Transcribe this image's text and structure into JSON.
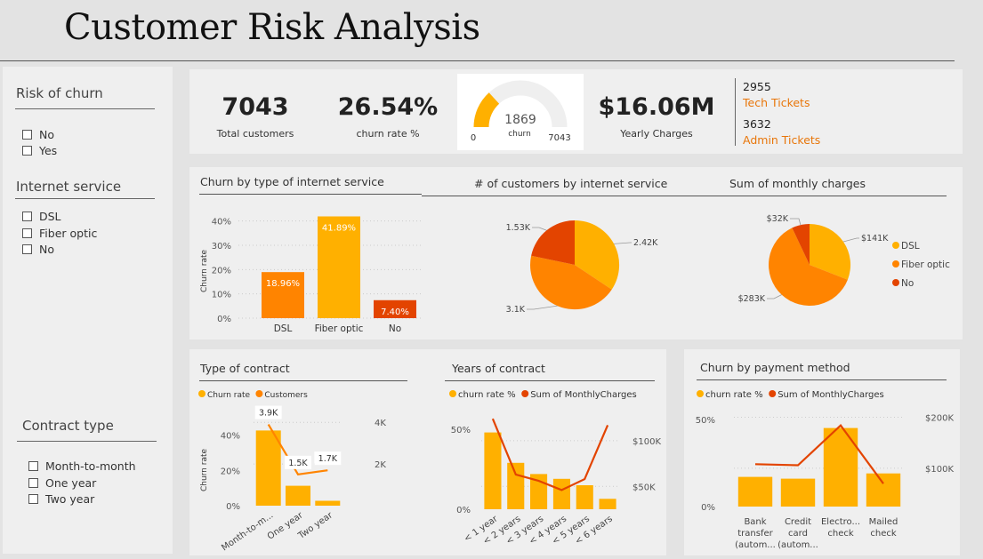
{
  "title": "Customer Risk Analysis",
  "slicers": {
    "risk": {
      "title": "Risk of churn",
      "options": [
        "No",
        "Yes"
      ]
    },
    "internet": {
      "title": "Internet service",
      "options": [
        "DSL",
        "Fiber optic",
        "No"
      ]
    },
    "contract": {
      "title": "Contract type",
      "options": [
        "Month-to-month",
        "One year",
        "Two year"
      ]
    }
  },
  "kpis": {
    "total_customers": {
      "value": "7043",
      "label": "Total customers"
    },
    "churn_rate": {
      "value": "26.54%",
      "label": "churn rate %"
    },
    "gauge": {
      "value": "1869",
      "label": "churn",
      "min": "0",
      "max": "7043",
      "fraction": 0.265
    },
    "yearly_charges": {
      "value": "$16.06M",
      "label": "Yearly Charges"
    },
    "tickets": {
      "tech_value": "2955",
      "tech_label": "Tech Tickets",
      "admin_value": "3632",
      "admin_label": "Admin Tickets"
    }
  },
  "colors": {
    "yellow": "#ffb000",
    "orange": "#ff8400",
    "red": "#e34400",
    "accent_text": "#e8760a"
  },
  "chart_data": [
    {
      "type": "bar",
      "title": "Churn by type of internet service",
      "ylabel": "Churn rate",
      "categories": [
        "DSL",
        "Fiber optic",
        "No"
      ],
      "values": [
        18.96,
        41.89,
        7.4
      ],
      "data_labels": [
        "18.96%",
        "41.89%",
        "7.40%"
      ],
      "yticks": [
        "0%",
        "10%",
        "20%",
        "30%",
        "40%"
      ],
      "ylim": [
        0,
        45
      ]
    },
    {
      "type": "pie",
      "title": "# of customers by internet service",
      "categories": [
        "DSL",
        "Fiber optic",
        "No"
      ],
      "values": [
        2420,
        3100,
        1530
      ],
      "data_labels": [
        "2.42K",
        "3.1K",
        "1.53K"
      ]
    },
    {
      "type": "pie",
      "title": "Sum of monthly charges",
      "categories": [
        "DSL",
        "Fiber optic",
        "No"
      ],
      "values": [
        141,
        283,
        32
      ],
      "data_labels": [
        "$141K",
        "$283K",
        "$32K"
      ],
      "legend": [
        "DSL",
        "Fiber optic",
        "No"
      ],
      "legend_position": "right"
    },
    {
      "type": "bar",
      "title": "Type of contract",
      "ylabel": "Churn rate",
      "legend": [
        "Churn rate",
        "Customers"
      ],
      "categories": [
        "Month-to-m...",
        "One year",
        "Two year"
      ],
      "series": [
        {
          "name": "Churn rate",
          "values": [
            42.7,
            11.3,
            2.8
          ]
        },
        {
          "name": "Customers",
          "values": [
            3900,
            1500,
            1700
          ],
          "data_labels": [
            "3.9K",
            "1.5K",
            "1.7K"
          ]
        }
      ],
      "yticks": [
        "0%",
        "20%",
        "40%"
      ],
      "y2ticks": [
        "2K",
        "4K"
      ]
    },
    {
      "type": "bar",
      "title": "Years of contract",
      "legend": [
        "churn rate %",
        "Sum of MonthlyCharges"
      ],
      "categories": [
        "< 1 year",
        "< 2 years",
        "< 3 years",
        "< 4 years",
        "< 5 years",
        "< 6 years"
      ],
      "series": [
        {
          "name": "churn rate %",
          "values": [
            48,
            29,
            22,
            19,
            15,
            6.5
          ]
        },
        {
          "name": "Sum of MonthlyCharges",
          "values": [
            124000,
            63000,
            56000,
            46000,
            58000,
            117000
          ]
        }
      ],
      "yticks": [
        "0%",
        "50%"
      ],
      "y2ticks": [
        "$50K",
        "$100K"
      ]
    },
    {
      "type": "bar",
      "title": "Churn by payment method",
      "legend": [
        "churn rate %",
        "Sum of MonthlyCharges"
      ],
      "categories": [
        "Bank transfer (autom...",
        "Credit card (autom...",
        "Electro... check",
        "Mailed check"
      ],
      "series": [
        {
          "name": "churn rate %",
          "values": [
            17,
            16,
            45,
            19
          ]
        },
        {
          "name": "Sum of MonthlyCharges",
          "values": [
            108000,
            106000,
            184000,
            70000
          ]
        }
      ],
      "yticks": [
        "0%",
        "50%"
      ],
      "y2ticks": [
        "$100K",
        "$200K"
      ]
    }
  ]
}
